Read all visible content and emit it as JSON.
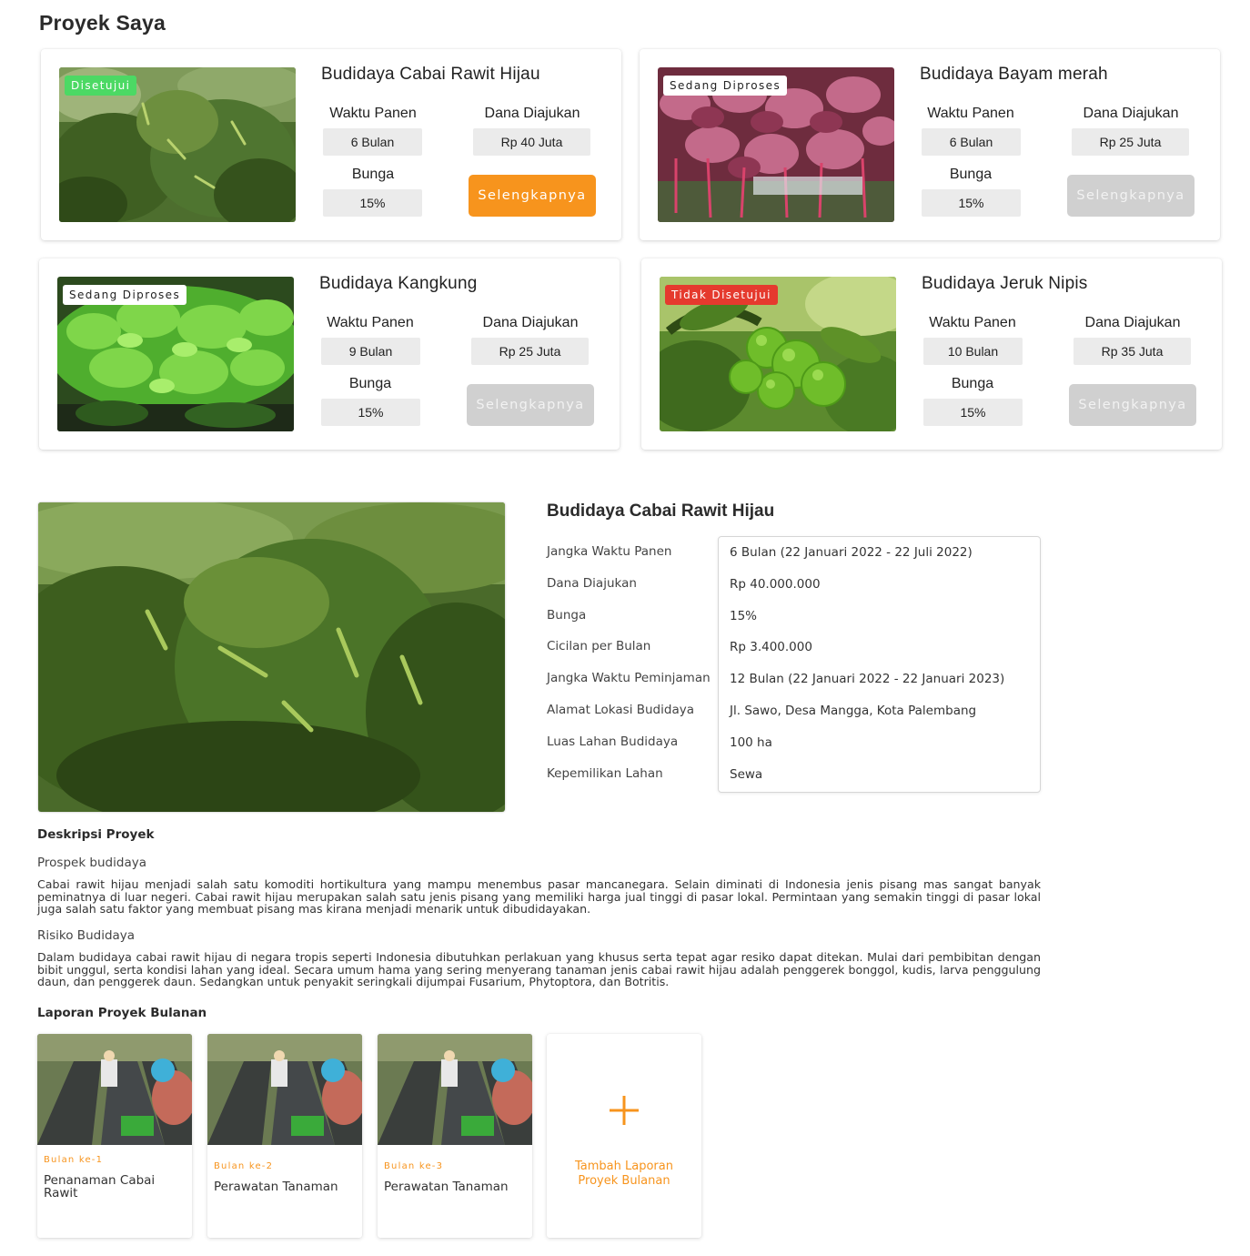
{
  "page_title": "Proyek Saya",
  "projects": [
    {
      "title": "Budidaya Cabai Rawit Hijau",
      "status": "Disetujui",
      "harvest_label": "Waktu Panen",
      "harvest_value": "6 Bulan",
      "fund_label": "Dana Diajukan",
      "fund_value": "Rp 40 Juta",
      "interest_label": "Bunga",
      "interest_value": "15%",
      "button_label": "Selengkapnya"
    },
    {
      "title": "Budidaya Bayam merah",
      "status": "Sedang Diproses",
      "harvest_label": "Waktu Panen",
      "harvest_value": "6 Bulan",
      "fund_label": "Dana Diajukan",
      "fund_value": "Rp 25 Juta",
      "interest_label": "Bunga",
      "interest_value": "15%",
      "button_label": "Selengkapnya"
    },
    {
      "title": "Budidaya Kangkung",
      "status": "Sedang Diproses",
      "harvest_label": "Waktu Panen",
      "harvest_value": "9 Bulan",
      "fund_label": "Dana Diajukan",
      "fund_value": "Rp 25 Juta",
      "interest_label": "Bunga",
      "interest_value": "15%",
      "button_label": "Selengkapnya"
    },
    {
      "title": "Budidaya Jeruk Nipis",
      "status": "Tidak Disetujui",
      "harvest_label": "Waktu Panen",
      "harvest_value": "10 Bulan",
      "fund_label": "Dana Diajukan",
      "fund_value": "Rp 35 Juta",
      "interest_label": "Bunga",
      "interest_value": "15%",
      "button_label": "Selengkapnya"
    }
  ],
  "colors": {
    "accent": "#f7941d",
    "approved": "#4cd964",
    "rejected": "#e53a2e",
    "disabled": "#d0d0d0"
  },
  "detail": {
    "title": "Budidaya Cabai Rawit Hijau",
    "rows": [
      {
        "label": "Jangka Waktu Panen",
        "value": "6 Bulan (22 Januari 2022 - 22 Juli 2022)"
      },
      {
        "label": "Dana Diajukan",
        "value": "Rp 40.000.000"
      },
      {
        "label": "Bunga",
        "value": "15%"
      },
      {
        "label": "Cicilan per Bulan",
        "value": "Rp 3.400.000"
      },
      {
        "label": "Jangka Waktu Peminjaman",
        "value": "12 Bulan (22 Januari 2022 - 22 Januari 2023)"
      },
      {
        "label": "Alamat Lokasi Budidaya",
        "value": "Jl. Sawo, Desa Mangga, Kota Palembang"
      },
      {
        "label": "Luas Lahan Budidaya",
        "value": "100 ha"
      },
      {
        "label": "Kepemilikan Lahan",
        "value": "Sewa"
      }
    ],
    "description_heading": "Deskripsi Proyek",
    "prospect_heading": "Prospek budidaya",
    "prospect_text": "Cabai rawit hijau menjadi salah satu komoditi hortikultura yang mampu menembus pasar mancanegara. Selain diminati di Indonesia jenis pisang mas sangat banyak peminatnya di luar negeri. Cabai rawit hijau merupakan salah satu jenis pisang yang memiliki harga jual tinggi di pasar lokal. Permintaan yang semakin tinggi di pasar lokal juga salah satu faktor yang membuat pisang mas kirana menjadi menarik untuk dibudidayakan.",
    "risk_heading": "Risiko Budidaya",
    "risk_text": "Dalam budidaya cabai rawit hijau di negara tropis seperti Indonesia dibutuhkan perlakuan yang khusus serta tepat agar resiko dapat ditekan. Mulai dari pembibitan dengan bibit unggul, serta kondisi lahan yang ideal. Secara umum hama yang sering menyerang tanaman jenis cabai rawit hijau adalah penggerek bonggol, kudis, larva penggulung daun, dan penggerek daun. Sedangkan untuk penyakit seringkali dijumpai Fusarium, Phytoptora, dan Botritis."
  },
  "reports": {
    "heading": "Laporan Proyek Bulanan",
    "items": [
      {
        "month": "Bulan ke-1",
        "title": "Penanaman Cabai Rawit"
      },
      {
        "month": "Bulan ke-2",
        "title": "Perawatan Tanaman"
      },
      {
        "month": "Bulan ke-3",
        "title": "Perawatan Tanaman"
      }
    ],
    "add_label": "Tambah Laporan Proyek Bulanan",
    "add_icon": "plus-icon"
  }
}
